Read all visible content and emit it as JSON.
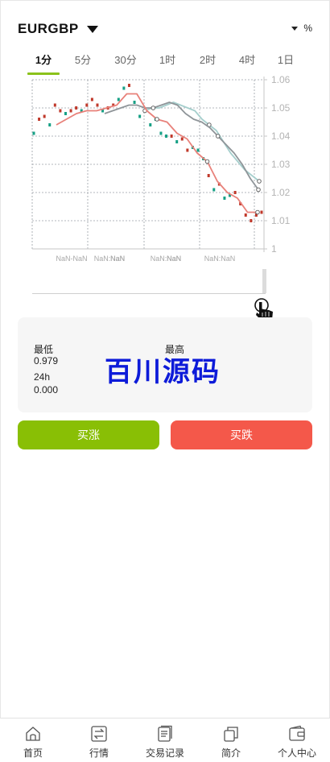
{
  "header": {
    "symbol": "EURGBP",
    "percent_label": "%"
  },
  "tabs": [
    {
      "label": "1分",
      "active": true
    },
    {
      "label": "5分",
      "active": false
    },
    {
      "label": "30分",
      "active": false
    },
    {
      "label": "1时",
      "active": false
    },
    {
      "label": "2时",
      "active": false
    },
    {
      "label": "4时",
      "active": false
    },
    {
      "label": "1日",
      "active": false
    }
  ],
  "accent_color": "#8bc21b",
  "chart_data": {
    "type": "candlestick",
    "y_ticks": [
      "1.06",
      "1.05",
      "1.04",
      "1.03",
      "1.02",
      "1.01",
      "1"
    ],
    "ylim": [
      1.0,
      1.06
    ],
    "x_labels": [
      "NaN-NaN",
      "NaN:NaN",
      "NaN",
      "NaN:NaN",
      "NaN",
      "NaN:NaN"
    ],
    "grid": true,
    "colors": {
      "up": "#16a085",
      "down": "#c0392b",
      "ma_red": "#e8817a",
      "ma_gray": "#8f9599",
      "ma_teal": "#a6cfcd"
    },
    "candles": [
      {
        "v": 1.041,
        "up": true
      },
      {
        "v": 1.046,
        "up": false
      },
      {
        "v": 1.047,
        "up": false
      },
      {
        "v": 1.044,
        "up": true
      },
      {
        "v": 1.051,
        "up": false
      },
      {
        "v": 1.049,
        "up": false
      },
      {
        "v": 1.048,
        "up": true
      },
      {
        "v": 1.049,
        "up": false
      },
      {
        "v": 1.05,
        "up": false
      },
      {
        "v": 1.049,
        "up": true
      },
      {
        "v": 1.051,
        "up": false
      },
      {
        "v": 1.053,
        "up": false
      },
      {
        "v": 1.051,
        "up": false
      },
      {
        "v": 1.049,
        "up": true
      },
      {
        "v": 1.05,
        "up": false
      },
      {
        "v": 1.051,
        "up": false
      },
      {
        "v": 1.053,
        "up": true
      },
      {
        "v": 1.057,
        "up": true
      },
      {
        "v": 1.058,
        "up": false
      },
      {
        "v": 1.052,
        "up": true
      },
      {
        "v": 1.047,
        "up": true
      },
      {
        "v": 1.049,
        "up": true
      },
      {
        "v": 1.044,
        "up": true
      },
      {
        "v": 1.046,
        "up": true
      },
      {
        "v": 1.041,
        "up": true
      },
      {
        "v": 1.04,
        "up": true
      },
      {
        "v": 1.04,
        "up": false
      },
      {
        "v": 1.038,
        "up": true
      },
      {
        "v": 1.039,
        "up": false
      },
      {
        "v": 1.035,
        "up": false
      },
      {
        "v": 1.036,
        "up": true
      },
      {
        "v": 1.035,
        "up": true
      },
      {
        "v": 1.032,
        "up": true
      },
      {
        "v": 1.026,
        "up": false
      },
      {
        "v": 1.021,
        "up": true
      },
      {
        "v": 1.023,
        "up": false
      },
      {
        "v": 1.018,
        "up": true
      },
      {
        "v": 1.019,
        "up": true
      },
      {
        "v": 1.02,
        "up": false
      },
      {
        "v": 1.016,
        "up": false
      },
      {
        "v": 1.012,
        "up": false
      },
      {
        "v": 1.01,
        "up": false
      },
      {
        "v": 1.012,
        "up": false
      },
      {
        "v": 1.013,
        "up": false
      }
    ],
    "ma_red": [
      1.044,
      1.046,
      1.048,
      1.049,
      1.049,
      1.05,
      1.051,
      1.055,
      1.055,
      1.049,
      1.046,
      1.045,
      1.041,
      1.039,
      1.034,
      1.031,
      1.024,
      1.02,
      1.018,
      1.013,
      1.013
    ],
    "ma_gray": [
      1.048,
      1.049,
      1.05,
      1.051,
      1.051,
      1.05,
      1.05,
      1.051,
      1.052,
      1.051,
      1.048,
      1.046,
      1.045,
      1.043,
      1.04,
      1.037,
      1.034,
      1.03,
      1.025,
      1.021
    ],
    "ma_teal": [
      1.049,
      1.05,
      1.05,
      1.051,
      1.052,
      1.051,
      1.05,
      1.049,
      1.046,
      1.044,
      1.042,
      1.038,
      1.034,
      1.031,
      1.028,
      1.026,
      1.024
    ]
  },
  "stats": {
    "low_label": "最低",
    "low_value": "0.979",
    "high_label": "最高",
    "range_label": "24h",
    "range_value": "0.000",
    "watermark": "百川源码"
  },
  "actions": {
    "buy_label": "买涨",
    "sell_label": "买跌"
  },
  "nav": [
    {
      "label": "首页",
      "icon": "home-icon"
    },
    {
      "label": "行情",
      "icon": "exchange-icon"
    },
    {
      "label": "交易记录",
      "icon": "document-icon"
    },
    {
      "label": "简介",
      "icon": "copy-icon"
    },
    {
      "label": "个人中心",
      "icon": "wallet-icon"
    }
  ]
}
